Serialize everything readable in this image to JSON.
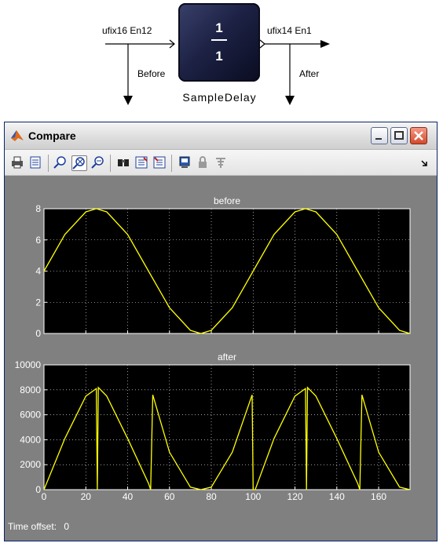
{
  "model": {
    "input_signal_type": "ufix16 En12",
    "output_signal_type": "ufix14 En1",
    "before_label": "Before",
    "after_label": "After",
    "block": {
      "numerator": "1",
      "denominator": "1",
      "name": "SampleDelay"
    }
  },
  "window": {
    "title": "Compare",
    "status": {
      "label": "Time offset:",
      "value": "0"
    }
  },
  "toolbar": {
    "icons": [
      "print-icon",
      "print-preview-icon",
      "zoom-in-icon",
      "zoom-xy-icon",
      "zoom-out-icon",
      "find-icon",
      "restore-axes-icon",
      "save-axes-icon",
      "parameters-icon",
      "lock-axes-icon",
      "floating-scope-icon"
    ]
  },
  "colors": {
    "signal": "#ffff00",
    "plot_bg": "#000000",
    "figure_bg": "#808080"
  },
  "chart_data": [
    {
      "type": "line",
      "title": "before",
      "xlim": [
        0,
        175
      ],
      "ylim": [
        0,
        8
      ],
      "xticks": [
        0,
        20,
        40,
        60,
        80,
        100,
        120,
        140,
        160
      ],
      "yticks": [
        0,
        2,
        4,
        6,
        8
      ],
      "ytick_labels": [
        "0",
        "2",
        "4",
        "6",
        "8"
      ],
      "show_x_ticklabels": false,
      "grid": true,
      "series": [
        {
          "x": [
            0,
            10,
            20,
            25,
            30,
            40,
            50,
            60,
            70,
            75,
            80,
            90,
            100,
            110,
            120,
            125,
            130,
            140,
            150,
            160,
            170,
            175
          ],
          "y": [
            4,
            6.35,
            7.8,
            8,
            7.8,
            6.35,
            4,
            1.65,
            0.2,
            0,
            0.2,
            1.65,
            4,
            6.35,
            7.8,
            8,
            7.8,
            6.35,
            4,
            1.65,
            0.2,
            0
          ]
        }
      ]
    },
    {
      "type": "line",
      "title": "after",
      "xlim": [
        0,
        175
      ],
      "ylim": [
        0,
        10000
      ],
      "xticks": [
        0,
        20,
        40,
        60,
        80,
        100,
        120,
        140,
        160
      ],
      "xtick_labels": [
        "0",
        "20",
        "40",
        "60",
        "80",
        "100",
        "120",
        "140",
        "160"
      ],
      "yticks": [
        0,
        2000,
        4000,
        6000,
        8000,
        10000
      ],
      "ytick_labels": [
        "0",
        "2000",
        "4000",
        "6000",
        "8000",
        "10000"
      ],
      "grid": true,
      "series": [
        {
          "x": [
            0,
            10,
            20,
            25,
            25.5,
            26,
            30,
            40,
            50,
            51,
            52,
            60,
            70,
            75,
            80,
            90,
            99.5,
            100,
            101,
            110,
            120,
            125,
            125.5,
            126,
            130,
            140,
            150,
            151,
            152,
            160,
            170,
            175
          ],
          "y": [
            0,
            4100,
            7500,
            8100,
            0,
            8190,
            7500,
            4100,
            500,
            0,
            7600,
            3000,
            200,
            0,
            200,
            3000,
            7600,
            0,
            0,
            4100,
            7500,
            8100,
            0,
            8190,
            7500,
            4100,
            500,
            0,
            7600,
            3000,
            200,
            0
          ]
        }
      ]
    }
  ]
}
